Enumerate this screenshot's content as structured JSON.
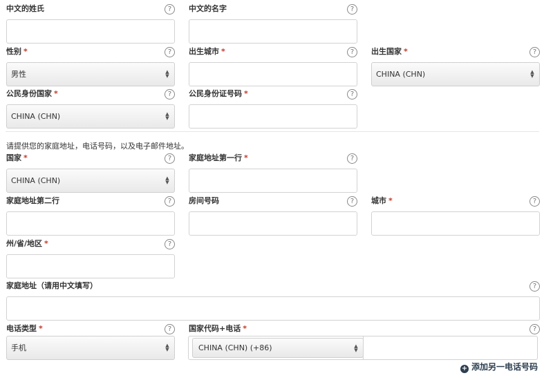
{
  "help_glyph": "?",
  "required_mark": "*",
  "rows": {
    "name": {
      "surname_cn": {
        "label": "中文的姓氏"
      },
      "given_name_cn": {
        "label": "中文的名字"
      }
    },
    "birth": {
      "gender": {
        "label": "性别",
        "value": "男性"
      },
      "birth_city": {
        "label": "出生城市"
      },
      "birth_country": {
        "label": "出生国家",
        "value": "CHINA (CHN)"
      }
    },
    "citizen": {
      "nationality": {
        "label": "公民身份国家",
        "value": "CHINA (CHN)"
      },
      "id_number": {
        "label": "公民身份证号码"
      }
    },
    "note": "请提供您的家庭地址，电话号码，以及电子邮件地址。",
    "address1": {
      "country": {
        "label": "国家",
        "value": "CHINA (CHN)"
      },
      "line1": {
        "label": "家庭地址第一行"
      }
    },
    "address2": {
      "line2": {
        "label": "家庭地址第二行"
      },
      "room": {
        "label": "房间号码"
      },
      "city": {
        "label": "城市"
      }
    },
    "address3": {
      "state": {
        "label": "州/省/地区"
      }
    },
    "address_cn": {
      "label": "家庭地址（请用中文填写）"
    },
    "phone": {
      "type": {
        "label": "电话类型",
        "value": "手机"
      },
      "number": {
        "label": "国家代码+电话",
        "code_value": "CHINA (CHN) (+86)"
      }
    }
  },
  "add_phone_label": "添加另一电话号码",
  "add_icon_glyph": "+"
}
